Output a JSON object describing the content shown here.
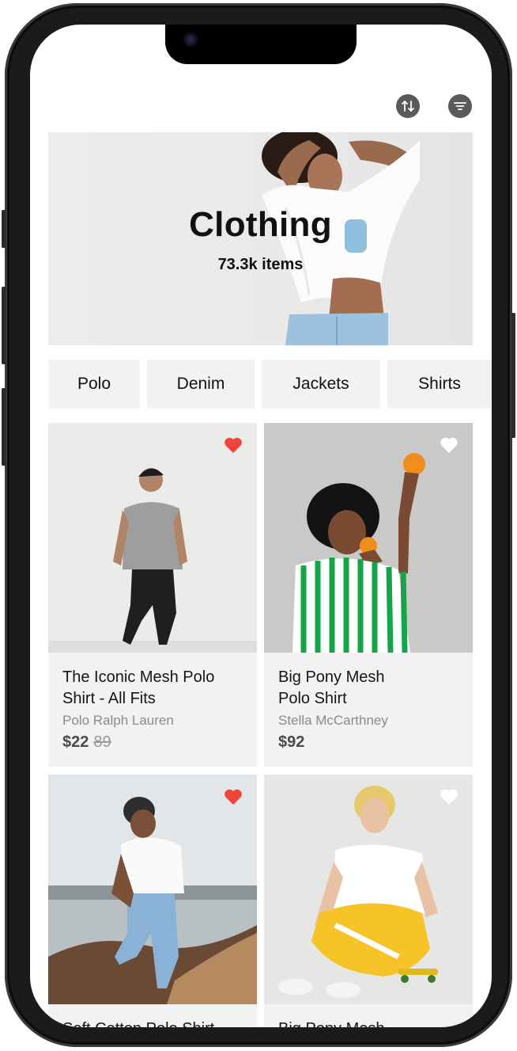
{
  "header": {
    "sort_icon": "sort-arrows-icon",
    "filter_icon": "filter-icon"
  },
  "hero": {
    "title": "Clothing",
    "subtitle": "73.3k items"
  },
  "categories": [
    "Polo",
    "Denim",
    "Jackets",
    "Shirts"
  ],
  "products": [
    {
      "title": "The Iconic Mesh Polo Shirt - All Fits",
      "brand": "Polo Ralph Lauren",
      "price": "$22",
      "old_price": "89",
      "favorite": true
    },
    {
      "title": "Big Pony Mesh Polo Shirt",
      "brand": "Stella McCarthney",
      "price": "$92",
      "old_price": "",
      "favorite": false
    },
    {
      "title": "Soft Cotton Polo Shirt",
      "brand": "",
      "price": "",
      "old_price": "",
      "favorite": true
    },
    {
      "title": "Big Pony Mesh",
      "brand": "",
      "price": "",
      "old_price": "",
      "favorite": false
    }
  ],
  "colors": {
    "heart_active": "#f04438",
    "heart_inactive": "#ffffff",
    "icon_bg": "#5a5a5a",
    "chip_bg": "#f2f2f2"
  }
}
